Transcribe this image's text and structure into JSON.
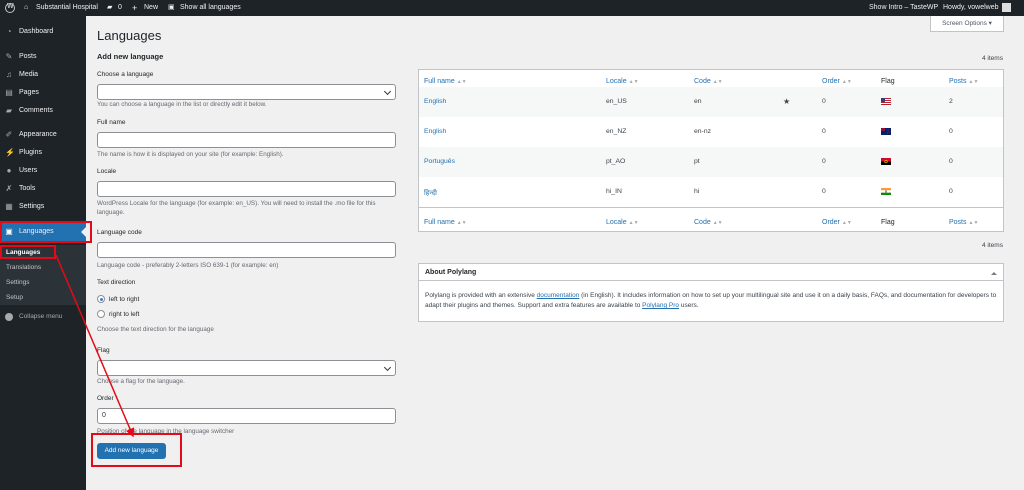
{
  "adminbar": {
    "site_name": "Substantial Hospital",
    "comments_count": "0",
    "new_label": "New",
    "languages_label": "Show all languages",
    "intro_label": "Show Intro – TasteWP",
    "howdy_label": "Howdy, vowelweb"
  },
  "sidebar": {
    "items": [
      {
        "label": "Dashboard",
        "icon": "dashboard-icon"
      },
      {
        "label": "Posts",
        "icon": "pin-icon"
      },
      {
        "label": "Media",
        "icon": "media-icon"
      },
      {
        "label": "Pages",
        "icon": "page-icon"
      },
      {
        "label": "Comments",
        "icon": "comment-icon"
      },
      {
        "label": "Appearance",
        "icon": "brush-icon"
      },
      {
        "label": "Plugins",
        "icon": "plug-icon"
      },
      {
        "label": "Users",
        "icon": "user-icon"
      },
      {
        "label": "Tools",
        "icon": "wrench-icon"
      },
      {
        "label": "Settings",
        "icon": "settings-icon"
      },
      {
        "label": "Languages",
        "icon": "translate-icon"
      }
    ],
    "submenu": [
      "Languages",
      "Translations",
      "Settings",
      "Setup"
    ],
    "collapse_label": "Collapse menu"
  },
  "page": {
    "title": "Languages",
    "screen_options": "Screen Options ▾"
  },
  "form": {
    "heading": "Add new language",
    "choose_label": "Choose a language",
    "choose_desc": "You can choose a language in the list or directly edit it below.",
    "fullname_label": "Full name",
    "fullname_desc": "The name is how it is displayed on your site (for example: English).",
    "locale_label": "Locale",
    "locale_desc": "WordPress Locale for the language (for example: en_US). You will need to install the .mo file for this language.",
    "code_label": "Language code",
    "code_desc": "Language code - preferably 2-letters ISO 639-1 (for example: en)",
    "direction_label": "Text direction",
    "ltr_label": "left to right",
    "rtl_label": "right to left",
    "direction_desc": "Choose the text direction for the language",
    "flag_label": "Flag",
    "flag_desc": "Choose a flag for the language.",
    "order_label": "Order",
    "order_value": "0",
    "order_desc": "Position of the language in the language switcher",
    "submit_label": "Add new language"
  },
  "table": {
    "count_top": "4 items",
    "count_bottom": "4 items",
    "headers": {
      "name": "Full name",
      "locale": "Locale",
      "code": "Code",
      "order": "Order",
      "flag": "Flag",
      "posts": "Posts"
    },
    "rows": [
      {
        "name": "English",
        "locale": "en_US",
        "code": "en",
        "default": true,
        "order": "0",
        "posts": "2",
        "flag": "us"
      },
      {
        "name": "English",
        "locale": "en_NZ",
        "code": "en-nz",
        "default": false,
        "order": "0",
        "posts": "0",
        "flag": "nz"
      },
      {
        "name": "Português",
        "locale": "pt_AO",
        "code": "pt",
        "default": false,
        "order": "0",
        "posts": "0",
        "flag": "ao"
      },
      {
        "name": "हिन्दी",
        "locale": "hi_IN",
        "code": "hi",
        "default": false,
        "order": "0",
        "posts": "0",
        "flag": "in"
      }
    ]
  },
  "about": {
    "title": "About Polylang",
    "text_1": "Polylang is provided with an extensive ",
    "link_1": "documentation",
    "text_2": " (in English). It includes information on how to set up your multilingual site and use it on a daily basis, FAQs, and documentation for developers to adapt their plugins and themes. Support and extra features are available to ",
    "link_2": "Polylang Pro",
    "text_3": " users."
  },
  "colors": {
    "accent": "#2271b1",
    "highlight": "#e30b17",
    "sidebar": "#1d2327"
  }
}
